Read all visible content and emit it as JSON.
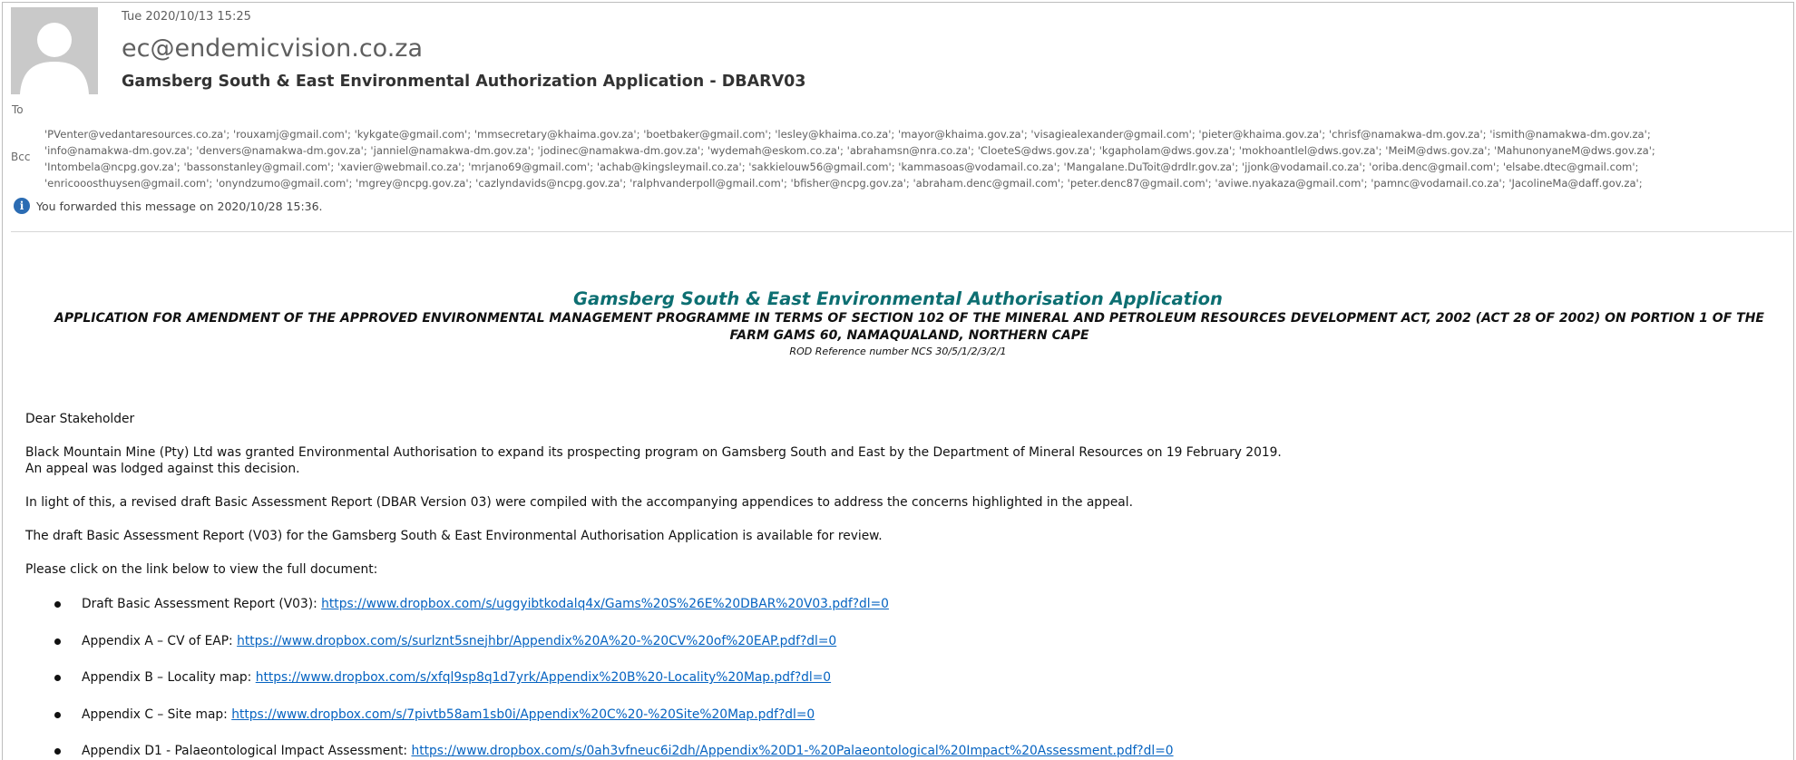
{
  "header": {
    "sent_date": "Tue 2020/10/13 15:25",
    "sender": "ec@endemicvision.co.za",
    "subject": "Gamsberg South & East Environmental Authorization Application - DBARV03",
    "to_label": "To",
    "bcc_label": "Bcc",
    "bcc_lines": [
      "'PVenter@vedantaresources.co.za'; 'rouxamj@gmail.com'; 'kykgate@gmail.com'; 'mmsecretary@khaima.gov.za'; 'boetbaker@gmail.com'; 'lesley@khaima.co.za'; 'mayor@khaima.gov.za'; 'visagiealexander@gmail.com'; 'pieter@khaima.gov.za'; 'chrisf@namakwa-dm.gov.za'; 'ismith@namakwa-dm.gov.za';",
      "'info@namakwa-dm.gov.za'; 'denvers@namakwa-dm.gov.za'; 'janniel@namakwa-dm.gov.za'; 'jodinec@namakwa-dm.gov.za'; 'wydemah@eskom.co.za'; 'abrahamsn@nra.co.za'; 'CloeteS@dws.gov.za'; 'kgapholam@dws.gov.za'; 'mokhoantlel@dws.gov.za'; 'MeiM@dws.gov.za'; 'MahunonyaneM@dws.gov.za';",
      "'Intombela@ncpg.gov.za'; 'bassonstanley@gmail.com'; 'xavier@webmail.co.za'; 'mrjano69@gmail.com'; 'achab@kingsleymail.co.za'; 'sakkielouw56@gmail.com'; 'kammasoas@vodamail.co.za'; 'Mangalane.DuToit@drdlr.gov.za'; 'jjonk@vodamail.co.za'; 'oriba.denc@gmail.com'; 'elsabe.dtec@gmail.com';",
      "'enricooosthuysen@gmail.com'; 'onyndzumo@gmail.com'; 'mgrey@ncpg.gov.za'; 'cazlyndavids@ncpg.gov.za'; 'ralphvanderpoll@gmail.com'; 'bfisher@ncpg.gov.za'; 'abraham.denc@gmail.com'; 'peter.denc87@gmail.com'; 'aviwe.nyakaza@gmail.com'; 'pamnc@vodamail.co.za'; 'JacolineMa@daff.gov.za';"
    ],
    "info_icon": "info-icon",
    "forwarded_notice": "You forwarded this message on 2020/10/28 15:36."
  },
  "body": {
    "title": "Gamsberg South & East Environmental Authorisation Application",
    "subtitle": "APPLICATION FOR AMENDMENT OF THE APPROVED ENVIRONMENTAL MANAGEMENT PROGRAMME IN TERMS OF SECTION 102 OF THE MINERAL AND PETROLEUM RESOURCES DEVELOPMENT ACT, 2002 (ACT 28 OF 2002) ON PORTION 1 OF THE FARM GAMS 60, NAMAQUALAND, NORTHERN CAPE",
    "reference": "ROD Reference number NCS 30/5/1/2/3/2/1",
    "greeting": "Dear Stakeholder",
    "para1_line1": "Black Mountain Mine (Pty) Ltd was granted Environmental Authorisation to expand its prospecting program on Gamsberg South and East by the Department of Mineral Resources on 19 February 2019.",
    "para1_line2": "An appeal was lodged against this decision.",
    "para2": "In light of this, a revised draft Basic Assessment Report (DBAR Version 03) were compiled with the accompanying appendices to address the concerns highlighted in the appeal.",
    "para3": "The draft Basic Assessment Report (V03) for the Gamsberg South & East Environmental Authorisation Application is available for review.",
    "para4": "Please click on the link below to view the full document:",
    "links": [
      {
        "label": "Draft Basic Assessment Report (V03): ",
        "url": "https://www.dropbox.com/s/uggyibtkodalq4x/Gams%20S%26E%20DBAR%20V03.pdf?dl=0"
      },
      {
        "label": "Appendix A – CV of EAP: ",
        "url": "https://www.dropbox.com/s/surlznt5snejhbr/Appendix%20A%20-%20CV%20of%20EAP.pdf?dl=0"
      },
      {
        "label": "Appendix B – Locality map: ",
        "url": "https://www.dropbox.com/s/xfql9sp8q1d7yrk/Appendix%20B%20-Locality%20Map.pdf?dl=0"
      },
      {
        "label": "Appendix C – Site map: ",
        "url": "https://www.dropbox.com/s/7pivtb58am1sb0i/Appendix%20C%20-%20Site%20Map.pdf?dl=0"
      },
      {
        "label": "Appendix D1 - Palaeontological Impact Assessment: ",
        "url": "https://www.dropbox.com/s/0ah3vfneuc6i2dh/Appendix%20D1-%20Palaeontological%20Impact%20Assessment.pdf?dl=0"
      }
    ]
  }
}
